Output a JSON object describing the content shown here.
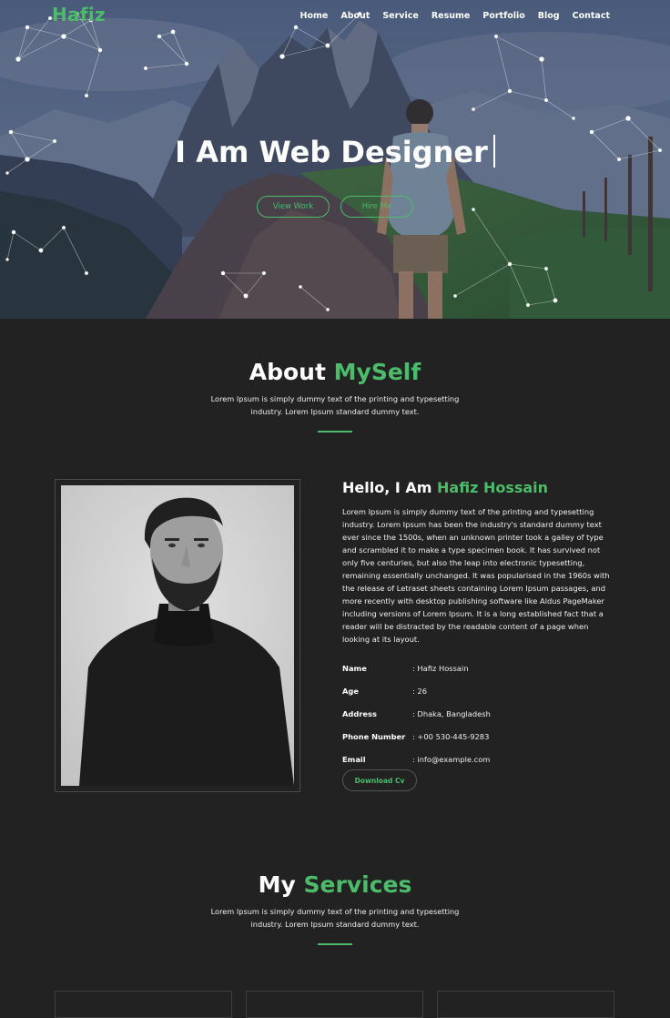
{
  "brand": {
    "logo": "Hafiz",
    "accent_color": "#4cbb6a",
    "background_color": "#222222"
  },
  "nav": {
    "items": [
      {
        "label": "Home"
      },
      {
        "label": "About"
      },
      {
        "label": "Service"
      },
      {
        "label": "Resume"
      },
      {
        "label": "Portfolio"
      },
      {
        "label": "Blog"
      },
      {
        "label": "Contact"
      }
    ]
  },
  "hero": {
    "title": "I Am Web Designer",
    "buttons": {
      "view_work": "View Work",
      "hire_me": "Hire Me"
    }
  },
  "about": {
    "heading_main": "About",
    "heading_accent": "MySelf",
    "intro": "Lorem Ipsum is simply dummy text of the printing and typesetting industry. Lorem Ipsum standard dummy text.",
    "greeting": "Hello, I Am",
    "name_accent": "Hafiz Hossain",
    "bio": "Lorem Ipsum is simply dummy text of the printing and typesetting industry. Lorem Ipsum has been the industry's standard dummy text ever since the 1500s, when an unknown printer took a galley of type and scrambled it to make a type specimen book. It has survived not only five centuries, but also the leap into electronic typesetting, remaining essentially unchanged. It was popularised in the 1960s with the release of Letraset sheets containing Lorem Ipsum passages, and more recently with desktop publishing software like Aldus PageMaker including versions of Lorem Ipsum. It is a long established fact that a reader will be distracted by the readable content of a page when looking at its layout.",
    "info": [
      {
        "key": "Name",
        "value": ": Hafiz Hossain"
      },
      {
        "key": "Age",
        "value": ": 26"
      },
      {
        "key": "Address",
        "value": ": Dhaka, Bangladesh"
      },
      {
        "key": "Phone Number",
        "value": ": +00 530-445-9283"
      },
      {
        "key": "Email",
        "value": ": info@example.com"
      }
    ],
    "download_label": "Download Cv"
  },
  "services": {
    "heading_main": "My",
    "heading_accent": "Services",
    "intro": "Lorem Ipsum is simply dummy text of the printing and typesetting industry. Lorem Ipsum standard dummy text."
  }
}
